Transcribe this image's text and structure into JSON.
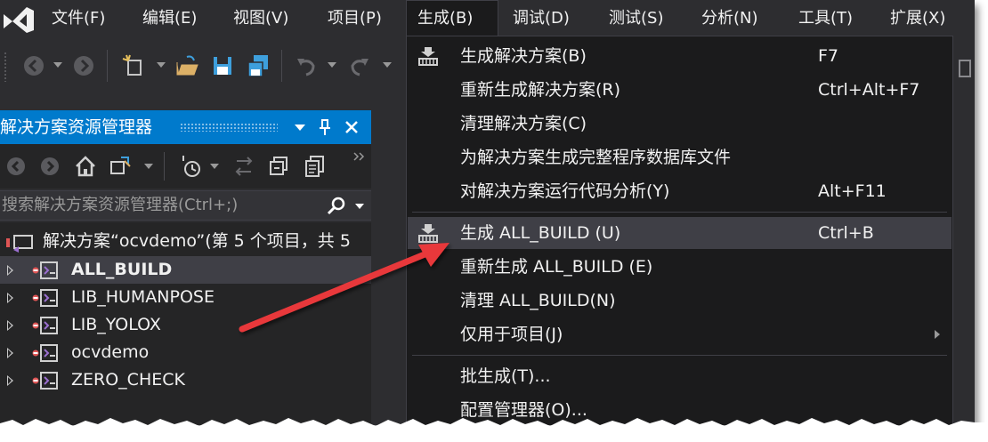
{
  "menubar": {
    "items": [
      "文件(F)",
      "编辑(E)",
      "视图(V)",
      "项目(P)",
      "生成(B)",
      "调试(D)",
      "测试(S)",
      "分析(N)",
      "工具(T)",
      "扩展(X)"
    ],
    "active_index": 4
  },
  "solution_explorer": {
    "title": "解决方案资源管理器",
    "search_placeholder": "搜索解决方案资源管理器(Ctrl+;)",
    "solution_label": "解决方案“ocvdemo”(第 5 个项目，共 5",
    "projects": [
      {
        "name": "ALL_BUILD",
        "selected": true
      },
      {
        "name": "LIB_HUMANPOSE",
        "selected": false
      },
      {
        "name": "LIB_YOLOX",
        "selected": false
      },
      {
        "name": "ocvdemo",
        "selected": false
      },
      {
        "name": "ZERO_CHECK",
        "selected": false
      }
    ]
  },
  "build_menu": {
    "items": [
      {
        "label": "生成解决方案(B)",
        "shortcut": "F7",
        "icon": "build-icon"
      },
      {
        "label": "重新生成解决方案(R)",
        "shortcut": "Ctrl+Alt+F7"
      },
      {
        "label": "清理解决方案(C)",
        "shortcut": ""
      },
      {
        "label": "为解决方案生成完整程序数据库文件",
        "shortcut": ""
      },
      {
        "label": "对解决方案运行代码分析(Y)",
        "shortcut": "Alt+F11"
      },
      {
        "label": "生成 ALL_BUILD (U)",
        "shortcut": "Ctrl+B",
        "icon": "build-icon",
        "highlighted": true
      },
      {
        "label": "重新生成 ALL_BUILD (E)",
        "shortcut": ""
      },
      {
        "label": "清理 ALL_BUILD(N)",
        "shortcut": ""
      },
      {
        "label": "仅用于项目(J)",
        "shortcut": "",
        "submenu": true
      },
      {
        "label": "批生成(T)...",
        "shortcut": ""
      },
      {
        "label": "配置管理器(O)...",
        "shortcut": ""
      }
    ]
  },
  "colors": {
    "background": "#2d2d30",
    "accent": "#007acc",
    "menu_bg": "#1b1b1c",
    "hover": "#3f3f46",
    "arrow": "#e8393a"
  }
}
